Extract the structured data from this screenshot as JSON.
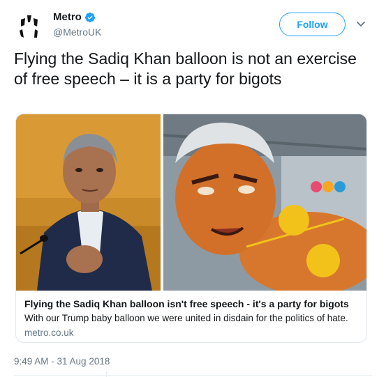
{
  "header": {
    "display_name": "Metro",
    "handle": "@MetroUK",
    "follow_label": "Follow",
    "avatar_icon": "metro-logo-icon",
    "verified_icon": "verified-badge-icon",
    "menu_icon": "chevron-down-icon"
  },
  "tweet": {
    "text": "Flying the Sadiq Khan balloon is not an exercise of free speech – it is a party for bigots",
    "timestamp": "9:49 AM - 31 Aug 2018"
  },
  "card": {
    "title": "Flying the Sadiq Khan balloon isn't free speech - it's a party for bigots",
    "description": "With our Trump baby balloon we were united in disdain for the politics of hate.",
    "domain": "metro.co.uk"
  },
  "colors": {
    "accent": "#1da1f2",
    "secondary_text": "#657786",
    "border": "#e1e8ed"
  }
}
